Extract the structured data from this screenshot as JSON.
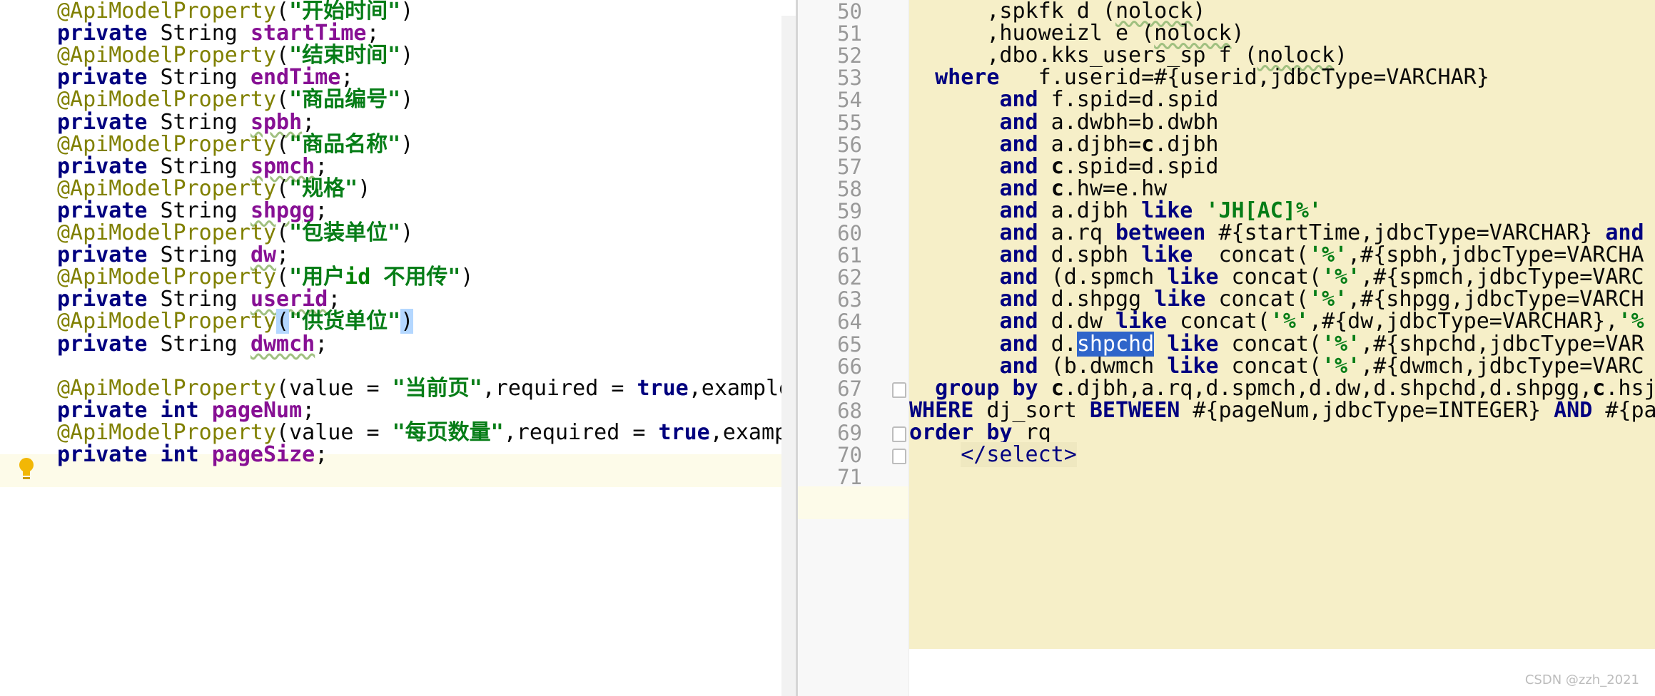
{
  "left_code": {
    "lines": [
      {
        "parts": [
          [
            "anno",
            "@ApiModelProperty"
          ],
          [
            "punc",
            "("
          ],
          [
            "str",
            "\"开始时间\""
          ],
          [
            "punc",
            ")"
          ]
        ]
      },
      {
        "parts": [
          [
            "kw",
            "private"
          ],
          [
            "ty",
            " String "
          ],
          [
            "fld",
            "startTime"
          ],
          [
            "punc",
            ";"
          ]
        ]
      },
      {
        "parts": [
          [
            "anno",
            "@ApiModelProperty"
          ],
          [
            "punc",
            "("
          ],
          [
            "str",
            "\"结束时间\""
          ],
          [
            "punc",
            ")"
          ]
        ]
      },
      {
        "parts": [
          [
            "kw",
            "private"
          ],
          [
            "ty",
            " String "
          ],
          [
            "fld",
            "endTime"
          ],
          [
            "punc",
            ";"
          ]
        ]
      },
      {
        "parts": [
          [
            "anno",
            "@ApiModelProperty"
          ],
          [
            "punc",
            "("
          ],
          [
            "str",
            "\"商品编号\""
          ],
          [
            "punc",
            ")"
          ]
        ]
      },
      {
        "parts": [
          [
            "kw",
            "private"
          ],
          [
            "ty",
            " String "
          ],
          [
            "fldw",
            "spbh"
          ],
          [
            "punc",
            ";"
          ]
        ]
      },
      {
        "parts": [
          [
            "anno",
            "@ApiModelProperty"
          ],
          [
            "punc",
            "("
          ],
          [
            "str",
            "\"商品名称\""
          ],
          [
            "punc",
            ")"
          ]
        ]
      },
      {
        "parts": [
          [
            "kw",
            "private"
          ],
          [
            "ty",
            " String "
          ],
          [
            "fldw",
            "spmch"
          ],
          [
            "punc",
            ";"
          ]
        ]
      },
      {
        "parts": [
          [
            "anno",
            "@ApiModelProperty"
          ],
          [
            "punc",
            "("
          ],
          [
            "str",
            "\"规格\""
          ],
          [
            "punc",
            ")"
          ]
        ]
      },
      {
        "parts": [
          [
            "kw",
            "private"
          ],
          [
            "ty",
            " String "
          ],
          [
            "fldw",
            "shpgg"
          ],
          [
            "punc",
            ";"
          ]
        ]
      },
      {
        "parts": [
          [
            "anno",
            "@ApiModelProperty"
          ],
          [
            "punc",
            "("
          ],
          [
            "str",
            "\"包装单位\""
          ],
          [
            "punc",
            ")"
          ]
        ]
      },
      {
        "parts": [
          [
            "kw",
            "private"
          ],
          [
            "ty",
            " String "
          ],
          [
            "fldw",
            "dw"
          ],
          [
            "punc",
            ";"
          ]
        ]
      },
      {
        "parts": [
          [
            "anno",
            "@ApiModelProperty"
          ],
          [
            "punc",
            "("
          ],
          [
            "str",
            "\"用户"
          ],
          [
            "idkw",
            "id"
          ],
          [
            "str",
            " 不用传\""
          ],
          [
            "punc",
            ")"
          ]
        ]
      },
      {
        "parts": [
          [
            "kw",
            "private"
          ],
          [
            "ty",
            " String "
          ],
          [
            "fldw",
            "userid"
          ],
          [
            "punc",
            ";"
          ]
        ]
      },
      {
        "parts": [
          [
            "anno",
            "@ApiModelProperty"
          ],
          [
            "sel",
            "("
          ],
          [
            "str",
            "\"供货单位\""
          ],
          [
            "sel",
            ")"
          ]
        ]
      },
      {
        "parts": [
          [
            "kw",
            "private"
          ],
          [
            "ty",
            " String "
          ],
          [
            "fldw",
            "dwmch"
          ],
          [
            "punc",
            ";"
          ]
        ]
      },
      {
        "parts": []
      },
      {
        "parts": [
          [
            "anno",
            "@ApiModelProperty"
          ],
          [
            "punc",
            "(value = "
          ],
          [
            "str",
            "\"当前页\""
          ],
          [
            "punc",
            ",required = "
          ],
          [
            "kw",
            "true"
          ],
          [
            "punc",
            ",example"
          ]
        ]
      },
      {
        "parts": [
          [
            "kw",
            "private int"
          ],
          [
            "ty",
            " "
          ],
          [
            "fld",
            "pageNum"
          ],
          [
            "punc",
            ";"
          ]
        ]
      },
      {
        "parts": [
          [
            "anno",
            "@ApiModelProperty"
          ],
          [
            "punc",
            "(value = "
          ],
          [
            "str",
            "\"每页数量\""
          ],
          [
            "punc",
            ",required = "
          ],
          [
            "kw",
            "true"
          ],
          [
            "punc",
            ",exampl"
          ]
        ]
      },
      {
        "parts": [
          [
            "kw",
            "private int"
          ],
          [
            "ty",
            " "
          ],
          [
            "fld",
            "pageSize"
          ],
          [
            "punc",
            ";"
          ]
        ]
      }
    ]
  },
  "right_code": {
    "line_numbers": [
      "50",
      "51",
      "52",
      "53",
      "54",
      "55",
      "56",
      "57",
      "58",
      "59",
      "60",
      "61",
      "62",
      "63",
      "64",
      "65",
      "66",
      "67",
      "68",
      "69",
      "70",
      "71"
    ],
    "lines": [
      {
        "parts": [
          [
            "t",
            "      ,spkfk d ("
          ],
          [
            "nl",
            "nolock"
          ],
          [
            "t",
            ")"
          ]
        ]
      },
      {
        "parts": [
          [
            "t",
            "      ,huoweizl e ("
          ],
          [
            "nl",
            "nolock"
          ],
          [
            "t",
            ")"
          ]
        ]
      },
      {
        "parts": [
          [
            "t",
            "      ,dbo.kks_users_sp f ("
          ],
          [
            "nl",
            "nolock"
          ],
          [
            "t",
            ")"
          ]
        ]
      },
      {
        "parts": [
          [
            "t",
            "  "
          ],
          [
            "k",
            "where"
          ],
          [
            "t",
            "   f.userid=#{userid,jdbcType=VARCHAR}"
          ]
        ]
      },
      {
        "parts": [
          [
            "t",
            "       "
          ],
          [
            "k",
            "and"
          ],
          [
            "t",
            " f.spid=d.spid"
          ]
        ]
      },
      {
        "parts": [
          [
            "t",
            "       "
          ],
          [
            "k",
            "and"
          ],
          [
            "t",
            " a.dwbh=b.dwbh"
          ]
        ]
      },
      {
        "parts": [
          [
            "t",
            "       "
          ],
          [
            "k",
            "and"
          ],
          [
            "t",
            " a.djbh="
          ],
          [
            "b",
            "c"
          ],
          [
            "t",
            ".djbh"
          ]
        ]
      },
      {
        "parts": [
          [
            "t",
            "       "
          ],
          [
            "k",
            "and"
          ],
          [
            "t",
            " "
          ],
          [
            "b",
            "c"
          ],
          [
            "t",
            ".spid=d.spid"
          ]
        ]
      },
      {
        "parts": [
          [
            "t",
            "       "
          ],
          [
            "k",
            "and"
          ],
          [
            "t",
            " "
          ],
          [
            "b",
            "c"
          ],
          [
            "t",
            ".hw=e.hw"
          ]
        ]
      },
      {
        "parts": [
          [
            "t",
            "       "
          ],
          [
            "k",
            "and"
          ],
          [
            "t",
            " a.djbh "
          ],
          [
            "k",
            "like"
          ],
          [
            "t",
            " "
          ],
          [
            "s",
            "'JH[AC]%'"
          ]
        ]
      },
      {
        "parts": [
          [
            "t",
            "       "
          ],
          [
            "k",
            "and"
          ],
          [
            "t",
            " a.rq "
          ],
          [
            "k",
            "between"
          ],
          [
            "t",
            " #{startTime,jdbcType=VARCHAR} "
          ],
          [
            "k",
            "and"
          ]
        ]
      },
      {
        "parts": [
          [
            "t",
            "       "
          ],
          [
            "k",
            "and"
          ],
          [
            "t",
            " d.spbh "
          ],
          [
            "k",
            "like"
          ],
          [
            "t",
            "  concat("
          ],
          [
            "s",
            "'%'"
          ],
          [
            "t",
            ",#{spbh,jdbcType=VARCHA"
          ]
        ]
      },
      {
        "parts": [
          [
            "t",
            "       "
          ],
          [
            "k",
            "and"
          ],
          [
            "t",
            " (d.spmch "
          ],
          [
            "k",
            "like"
          ],
          [
            "t",
            " concat("
          ],
          [
            "s",
            "'%'"
          ],
          [
            "t",
            ",#{spmch,jdbcType=VARC"
          ]
        ]
      },
      {
        "parts": [
          [
            "t",
            "       "
          ],
          [
            "k",
            "and"
          ],
          [
            "t",
            " d.shpgg "
          ],
          [
            "k",
            "like"
          ],
          [
            "t",
            " concat("
          ],
          [
            "s",
            "'%'"
          ],
          [
            "t",
            ",#{shpgg,jdbcType=VARCH"
          ]
        ]
      },
      {
        "parts": [
          [
            "t",
            "       "
          ],
          [
            "k",
            "and"
          ],
          [
            "t",
            " d.dw "
          ],
          [
            "k",
            "like"
          ],
          [
            "t",
            " concat("
          ],
          [
            "s",
            "'%'"
          ],
          [
            "t",
            ",#{dw,jdbcType=VARCHAR},"
          ],
          [
            "s",
            "'%"
          ]
        ]
      },
      {
        "parts": [
          [
            "t",
            "       "
          ],
          [
            "k",
            "and"
          ],
          [
            "t",
            " d."
          ],
          [
            "h",
            "shpchd"
          ],
          [
            "t",
            " "
          ],
          [
            "k",
            "like"
          ],
          [
            "t",
            " concat("
          ],
          [
            "s",
            "'%'"
          ],
          [
            "t",
            ",#{shpchd,jdbcType=VAR"
          ]
        ]
      },
      {
        "parts": [
          [
            "t",
            "       "
          ],
          [
            "k",
            "and"
          ],
          [
            "t",
            " (b.dwmch "
          ],
          [
            "k",
            "like"
          ],
          [
            "t",
            " concat("
          ],
          [
            "s",
            "'%'"
          ],
          [
            "t",
            ",#{dwmch,jdbcType=VARC"
          ]
        ]
      },
      {
        "parts": [
          [
            "t",
            "  "
          ],
          [
            "k",
            "group by"
          ],
          [
            "t",
            " "
          ],
          [
            "b",
            "c"
          ],
          [
            "t",
            ".djbh,a.rq,d.spmch,d.dw,d.shpchd,d.shpgg,"
          ],
          [
            "b",
            "c"
          ],
          [
            "t",
            ".hsj"
          ]
        ]
      },
      {
        "parts": [
          [
            "k",
            "WHERE"
          ],
          [
            "t",
            " dj_sort "
          ],
          [
            "k",
            "BETWEEN"
          ],
          [
            "t",
            " #{pageNum,jdbcType=INTEGER} "
          ],
          [
            "k",
            "AND"
          ],
          [
            "t",
            " #{pa"
          ]
        ]
      },
      {
        "parts": [
          [
            "k",
            "order by"
          ],
          [
            "t",
            " rq"
          ]
        ]
      },
      {
        "parts": [
          [
            "t",
            "    "
          ],
          [
            "tag",
            "</select>"
          ]
        ]
      },
      {
        "parts": []
      }
    ]
  },
  "watermark": "CSDN @zzh_2021",
  "colors": {
    "annotation": "#808000",
    "string": "#067d17",
    "keyword": "#000080",
    "field": "#871094",
    "sql_background": "#f6efc8",
    "selection_highlight": "#2f65ca"
  }
}
